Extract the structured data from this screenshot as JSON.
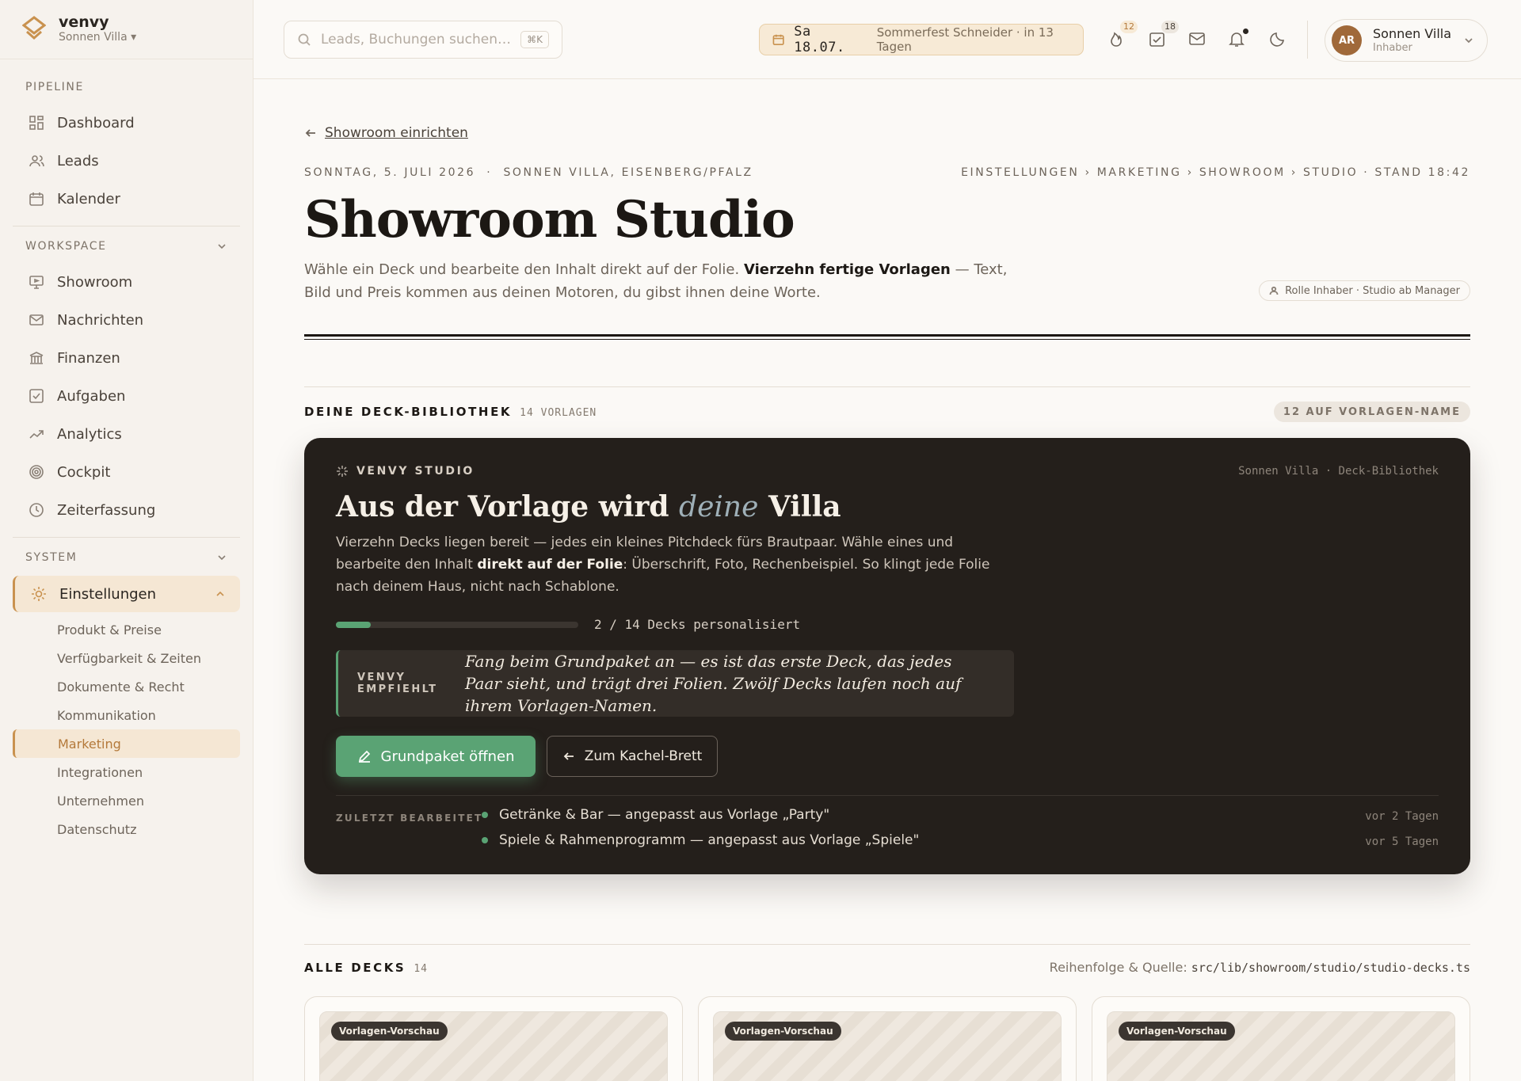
{
  "brand": {
    "name": "venvy",
    "venue": "Sonnen Villa"
  },
  "sidebar": {
    "pipeline_label": "PIPELINE",
    "pipeline": [
      {
        "label": "Dashboard",
        "icon": "grid-icon"
      },
      {
        "label": "Leads",
        "icon": "users-icon"
      },
      {
        "label": "Kalender",
        "icon": "calendar-icon"
      }
    ],
    "workspace_label": "WORKSPACE",
    "workspace": [
      {
        "label": "Showroom",
        "icon": "monitor-icon"
      },
      {
        "label": "Nachrichten",
        "icon": "mail-icon"
      },
      {
        "label": "Finanzen",
        "icon": "bank-icon"
      },
      {
        "label": "Aufgaben",
        "icon": "checkbox-icon"
      },
      {
        "label": "Analytics",
        "icon": "trend-icon"
      },
      {
        "label": "Cockpit",
        "icon": "target-icon"
      },
      {
        "label": "Zeiterfassung",
        "icon": "clock-icon"
      }
    ],
    "system_label": "SYSTEM",
    "settings_label": "Einstellungen",
    "settings_sub": [
      "Produkt & Preise",
      "Verfügbarkeit & Zeiten",
      "Dokumente & Recht",
      "Kommunikation",
      "Marketing",
      "Integrationen",
      "Unternehmen",
      "Datenschutz"
    ],
    "active_sub": "Marketing"
  },
  "topbar": {
    "search_placeholder": "Leads, Buchungen suchen…",
    "search_shortcut": "⌘K",
    "event_date": "Sa 18.07.",
    "event_text": "Sommerfest Schneider · in 13 Tagen",
    "badge_fire": "12",
    "badge_tasks": "18",
    "user_name": "Sonnen Villa",
    "user_role": "Inhaber",
    "user_initials": "AR"
  },
  "page": {
    "back_label": "Showroom einrichten",
    "meta_left": "SONNTAG, 5. JULI 2026  ·  SONNEN VILLA, EISENBERG/PFALZ",
    "meta_right": "EINSTELLUNGEN › MARKETING › SHOWROOM › STUDIO · STAND 18:42",
    "title": "Showroom Studio",
    "lead_a": "Wähle ein Deck und bearbeite den Inhalt direkt auf der Folie. ",
    "lead_b": "Vierzehn fertige Vorlagen",
    "lead_c": " — Text, Bild und Preis kommen aus deinen Motoren, du gibst ihnen deine Worte.",
    "role_chip": "Rolle Inhaber · Studio ab Manager"
  },
  "library": {
    "title": "DEINE DECK-BIBLIOTHEK",
    "count": "14 VORLAGEN",
    "pill": "12 AUF VORLAGEN-NAME"
  },
  "studio": {
    "eyebrow": "VENVY STUDIO",
    "meta": "Sonnen Villa · Deck-Bibliothek",
    "title_a": "Aus der Vorlage wird ",
    "title_b": "deine",
    "title_c": " Villa",
    "text_a": "Vierzehn Decks liegen bereit — jedes ein kleines Pitchdeck fürs Brautpaar. Wähle eines und bearbeite den Inhalt ",
    "text_b": "direkt auf der Folie",
    "text_c": ": Überschrift, Foto, Rechenbeispiel. So klingt jede Folie nach deinem Haus, nicht nach Schablone.",
    "progress": 0.1429,
    "progress_label": "2 / 14 Decks personalisiert",
    "rec_label": "VENVY EMPFIEHLT",
    "rec_text": "Fang beim Grundpaket an — es ist das erste Deck, das jedes Paar sieht, und trägt drei Folien. Zwölf Decks laufen noch auf ihrem Vorlagen-Namen.",
    "primary_button": "Grundpaket öffnen",
    "secondary_button": "Zum Kachel-Brett",
    "recent_label": "ZULETZT BEARBEITET",
    "recent": [
      {
        "text": "Getränke & Bar — angepasst aus Vorlage „Party\"",
        "when": "vor 2 Tagen"
      },
      {
        "text": "Spiele & Rahmenprogramm — angepasst aus Vorlage „Spiele\"",
        "when": "vor 5 Tagen"
      }
    ]
  },
  "all_decks": {
    "title": "ALLE DECKS",
    "count": "14",
    "source_label": "Reihenfolge & Quelle: ",
    "source_path": "src/lib/showroom/studio/studio-decks.ts",
    "preview_tag": "Vorlagen-Vorschau"
  },
  "colors": {
    "accent": "#c9924f",
    "green": "#5aa374",
    "dark": "#241f1b"
  }
}
